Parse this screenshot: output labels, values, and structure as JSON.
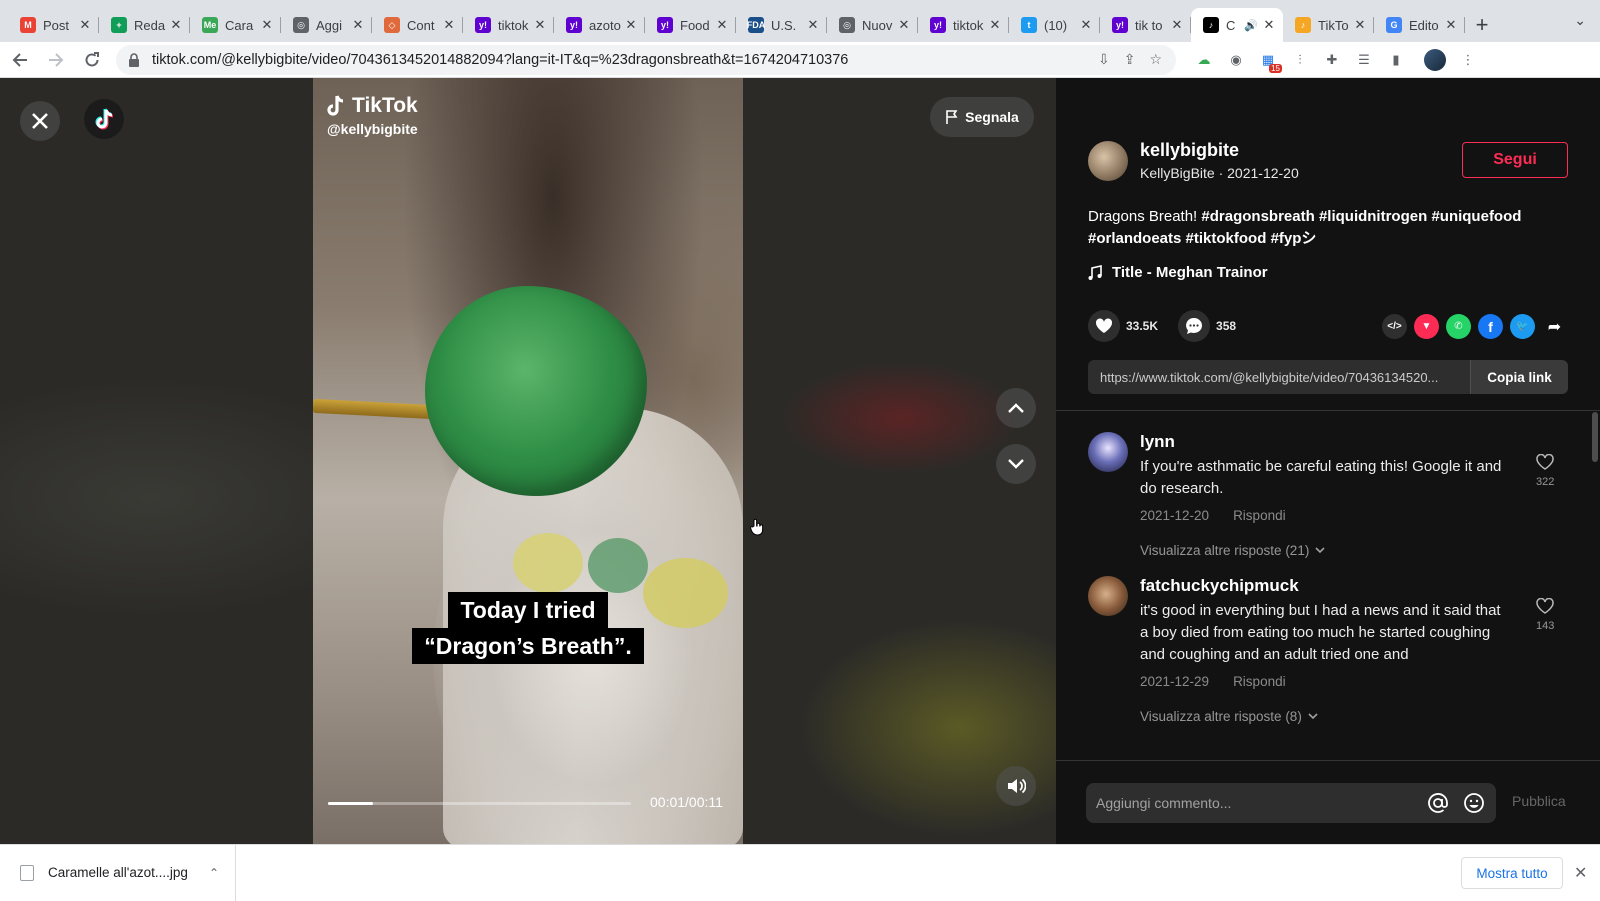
{
  "browser": {
    "tabs": [
      {
        "title": "Post",
        "favicon": "gmail-icon",
        "color": "#ea4335",
        "letter": "M"
      },
      {
        "title": "Reda",
        "favicon": "sheets-icon",
        "color": "#0f9d58",
        "letter": "+"
      },
      {
        "title": "Cara",
        "favicon": "me-icon",
        "color": "#3aa757",
        "letter": "Me"
      },
      {
        "title": "Aggi",
        "favicon": "globe-icon",
        "color": "#5f6368",
        "letter": "◎"
      },
      {
        "title": "Cont",
        "favicon": "cont-icon",
        "color": "#e06a3b",
        "letter": "◇"
      },
      {
        "title": "tiktok",
        "favicon": "yahoo-icon",
        "color": "#5f01d1",
        "letter": "y!"
      },
      {
        "title": "azoto",
        "favicon": "yahoo-icon",
        "color": "#5f01d1",
        "letter": "y!"
      },
      {
        "title": "Food",
        "favicon": "yahoo-icon",
        "color": "#5f01d1",
        "letter": "y!"
      },
      {
        "title": "U.S.",
        "favicon": "fda-icon",
        "color": "#1b4f8a",
        "letter": "FDA"
      },
      {
        "title": "Nuov",
        "favicon": "globe-icon",
        "color": "#5f6368",
        "letter": "◎"
      },
      {
        "title": "tiktok",
        "favicon": "yahoo-icon",
        "color": "#5f01d1",
        "letter": "y!"
      },
      {
        "title": "(10)",
        "favicon": "twitter-icon",
        "color": "#1d9bf0",
        "letter": "t"
      },
      {
        "title": "tik to",
        "favicon": "yahoo-icon",
        "color": "#5f01d1",
        "letter": "y!"
      },
      {
        "title": "C",
        "favicon": "tiktok-icon",
        "color": "#000000",
        "letter": "♪",
        "active": true
      },
      {
        "title": "TikTo",
        "favicon": "tiktok-icon",
        "color": "#f5a623",
        "letter": "♪"
      },
      {
        "title": "Edito",
        "favicon": "google-icon",
        "color": "#4285f4",
        "letter": "G"
      }
    ],
    "url": "tiktok.com/@kellybigbite/video/7043613452014882094?lang=it-IT&q=%23dragonsbreath&t=1674204710376",
    "ext_badge": "15"
  },
  "video": {
    "watermark_brand": "TikTok",
    "watermark_user": "@kellybigbite",
    "caption_lines": [
      "Today I tried",
      "“Dragon’s Breath”."
    ],
    "time": "00:01/00:11",
    "progress": 0.15,
    "report_label": "Segnala"
  },
  "author": {
    "username": "kellybigbite",
    "subline": "KellyBigBite · 2021-12-20",
    "follow_label": "Segui"
  },
  "description": {
    "text": "Dragons Breath!",
    "hashtags": [
      "#dragonsbreath",
      "#liquidnitrogen",
      "#uniquefood",
      "#orlandoeats",
      "#tiktokfood",
      "#fypシ"
    ]
  },
  "music": "Title - Meghan Trainor",
  "stats": {
    "likes": "33.5K",
    "comments": "358"
  },
  "link": {
    "url": "https://www.tiktok.com/@kellybigbite/video/70436134520...",
    "copy_label": "Copia link"
  },
  "comments": [
    {
      "user": "lynn",
      "text": "If you're asthmatic be careful eating this! Google it and do research.",
      "date": "2021-12-20",
      "reply_label": "Rispondi",
      "likes": "322",
      "more": "Visualizza altre risposte (21)"
    },
    {
      "user": "fatchuckychipmuck",
      "text": "it's good in everything but I had a news and it said that a boy died from eating too much he started coughing and coughing and an adult tried one and",
      "date": "2021-12-29",
      "reply_label": "Rispondi",
      "likes": "143",
      "more": "Visualizza altre risposte (8)"
    }
  ],
  "composer": {
    "placeholder": "Aggiungi commento...",
    "post_label": "Pubblica"
  },
  "downloads": {
    "file": "Caramelle all'azot....jpg",
    "show_all": "Mostra tutto"
  }
}
